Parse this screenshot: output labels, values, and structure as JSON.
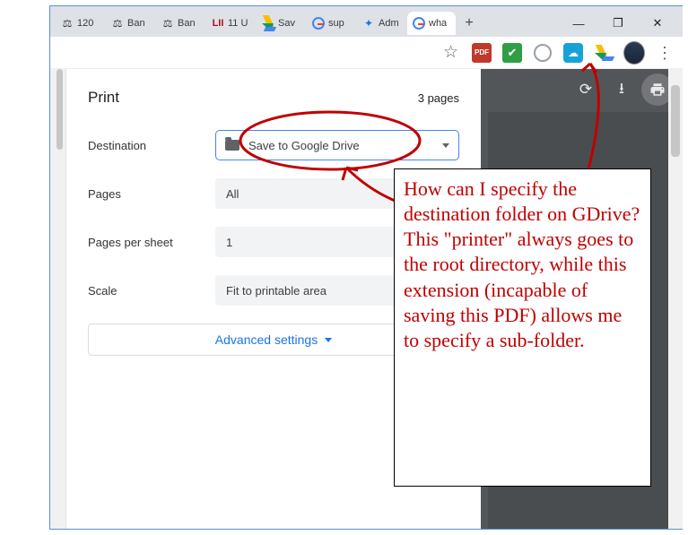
{
  "tabs": [
    {
      "label": "120"
    },
    {
      "label": "Ban"
    },
    {
      "label": "Ban"
    },
    {
      "label": "11 U"
    },
    {
      "label": "Sav"
    },
    {
      "label": "sup"
    },
    {
      "label": "Adm"
    },
    {
      "label": "wha"
    }
  ],
  "print": {
    "title": "Print",
    "page_count": "3 pages",
    "rows": {
      "destination_label": "Destination",
      "destination_value": "Save to Google Drive",
      "pages_label": "Pages",
      "pages_value": "All",
      "pps_label": "Pages per sheet",
      "pps_value": "1",
      "scale_label": "Scale",
      "scale_value": "Fit to printable area"
    },
    "advanced": "Advanced settings"
  },
  "annotation": {
    "text": "How can I specify the destination folder on GDrive? This \"printer\" always goes to the root directory, while this extension (incapable of saving this PDF) allows me to specify a sub-folder."
  },
  "colors": {
    "annotation_red": "#c00000",
    "google_blue": "#1a73e8"
  }
}
